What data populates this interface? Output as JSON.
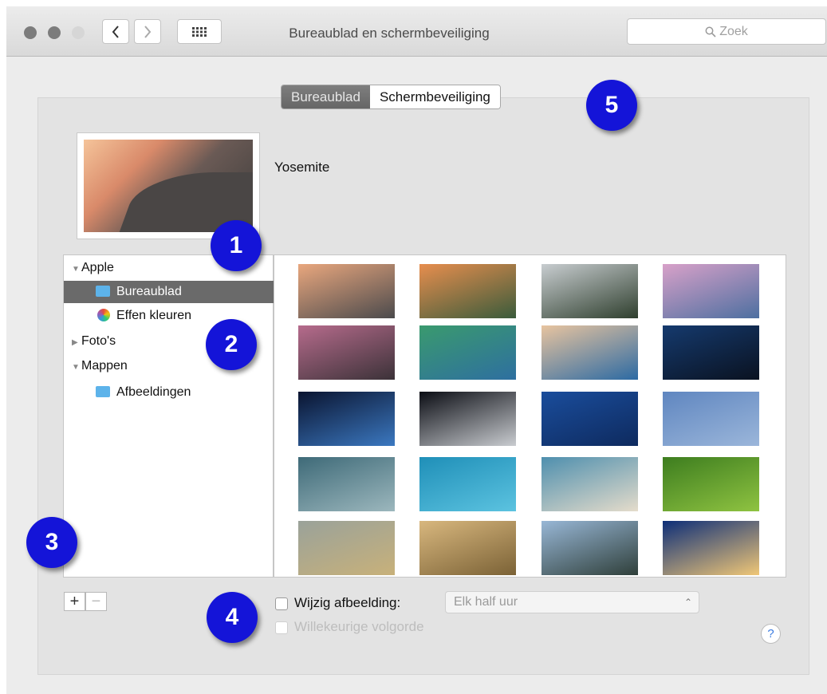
{
  "window": {
    "title": "Bureaublad en schermbeveiliging"
  },
  "search": {
    "placeholder": "Zoek"
  },
  "tabs": [
    {
      "label": "Bureaublad",
      "active": true
    },
    {
      "label": "Schermbeveiliging",
      "active": false
    }
  ],
  "preview": {
    "name": "Yosemite"
  },
  "sidebar": {
    "groups": [
      {
        "label": "Apple",
        "expanded": true,
        "items": [
          {
            "label": "Bureaublad",
            "selected": true,
            "icon": "folder-icon"
          },
          {
            "label": "Effen kleuren",
            "selected": false,
            "icon": "color-wheel-icon"
          }
        ]
      },
      {
        "label": "Foto's",
        "expanded": false
      },
      {
        "label": "Mappen",
        "expanded": true,
        "items": [
          {
            "label": "Afbeeldingen",
            "selected": false,
            "icon": "folder-icon"
          }
        ]
      }
    ]
  },
  "buttons": {
    "add": "+",
    "remove": "−"
  },
  "options": {
    "change_picture": {
      "label": "Wijzig afbeelding:",
      "checked": false
    },
    "interval": {
      "value": "Elk half uur",
      "enabled": false
    },
    "random_order": {
      "label": "Willekeurige volgorde",
      "checked": false,
      "enabled": false
    }
  },
  "help": {
    "label": "?"
  },
  "badges": [
    "1",
    "2",
    "3",
    "4",
    "5"
  ],
  "wallpapers": [
    [
      "#e9a77e",
      "#4b4a4c"
    ],
    [
      "#e78e4e",
      "#3a5b3b"
    ],
    [
      "#c8cdd0",
      "#2f3f2e"
    ],
    [
      "#d8a1c9",
      "#4d6fa0"
    ],
    [
      "#b66b8c",
      "#3b3238"
    ],
    [
      "#3a9a6e",
      "#2e6fa0"
    ],
    [
      "#e8c49f",
      "#2c6aa3"
    ],
    [
      "#153a6e",
      "#0a1220"
    ],
    [
      "#0a1430",
      "#3b78c0"
    ],
    [
      "#0b0d14",
      "#c9ccd0"
    ],
    [
      "#1a4d9c",
      "#0e2a5e"
    ],
    [
      "#5f86c0",
      "#9bb6da"
    ],
    [
      "#3e6a78",
      "#9cb7bd"
    ],
    [
      "#1f8fb8",
      "#5cc3e0"
    ],
    [
      "#4e8fae",
      "#e5dccb"
    ],
    [
      "#3d7d1f",
      "#8fc341"
    ],
    [
      "#9aa29a",
      "#c8b17a"
    ],
    [
      "#d8b77e",
      "#7b6236"
    ],
    [
      "#98b7d6",
      "#2f3f3a"
    ],
    [
      "#0d2e78",
      "#f0c777"
    ]
  ]
}
